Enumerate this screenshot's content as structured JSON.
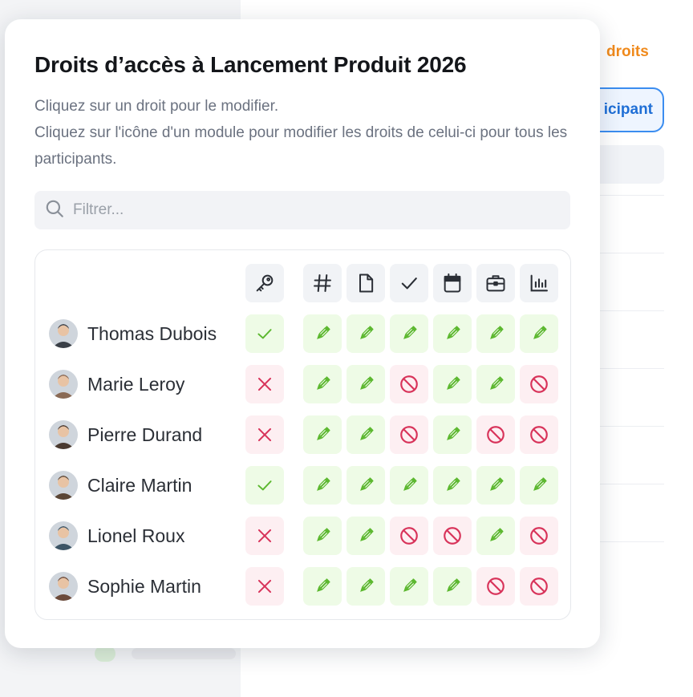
{
  "background": {
    "link_text": "droits",
    "button_text": "icipant"
  },
  "dialog": {
    "title": "Droits d’accès à Lancement Produit 2026",
    "description_line1": "Cliquez sur un droit pour le modifier.",
    "description_line2": "Cliquez sur l'icône d'un module pour modifier les droits de celui-ci pour tous les participants.",
    "filter_placeholder": "Filtrer..."
  },
  "modules": [
    {
      "icon": "key-icon",
      "label": "access"
    },
    {
      "icon": "hashtag-icon",
      "label": "channels"
    },
    {
      "icon": "document-icon",
      "label": "documents"
    },
    {
      "icon": "checkmark-icon",
      "label": "tasks"
    },
    {
      "icon": "calendar-icon",
      "label": "calendar"
    },
    {
      "icon": "briefcase-icon",
      "label": "projects"
    },
    {
      "icon": "bar-chart-icon",
      "label": "stats"
    }
  ],
  "participants": [
    {
      "name": "Thomas Dubois",
      "access": "granted",
      "rights": [
        "edit",
        "edit",
        "edit",
        "edit",
        "edit",
        "edit"
      ],
      "avatar_color": "#3a3f47"
    },
    {
      "name": "Marie Leroy",
      "access": "denied",
      "rights": [
        "edit",
        "edit",
        "forbidden",
        "edit",
        "edit",
        "forbidden"
      ],
      "avatar_color": "#8a6a55"
    },
    {
      "name": "Pierre Durand",
      "access": "denied",
      "rights": [
        "edit",
        "edit",
        "forbidden",
        "edit",
        "forbidden",
        "forbidden"
      ],
      "avatar_color": "#4a3a30"
    },
    {
      "name": "Claire Martin",
      "access": "granted",
      "rights": [
        "edit",
        "edit",
        "edit",
        "edit",
        "edit",
        "edit"
      ],
      "avatar_color": "#5b4636"
    },
    {
      "name": "Lionel Roux",
      "access": "denied",
      "rights": [
        "edit",
        "edit",
        "forbidden",
        "forbidden",
        "edit",
        "forbidden"
      ],
      "avatar_color": "#3d5566"
    },
    {
      "name": "Sophie Martin",
      "access": "denied",
      "rights": [
        "edit",
        "edit",
        "edit",
        "edit",
        "forbidden",
        "forbidden"
      ],
      "avatar_color": "#6b4a3a"
    }
  ],
  "colors": {
    "granted": "#5cb82f",
    "denied": "#d8335a",
    "header_icon": "#2b2f36",
    "accent_orange": "#f08a1c",
    "accent_blue": "#1f6fd6"
  }
}
